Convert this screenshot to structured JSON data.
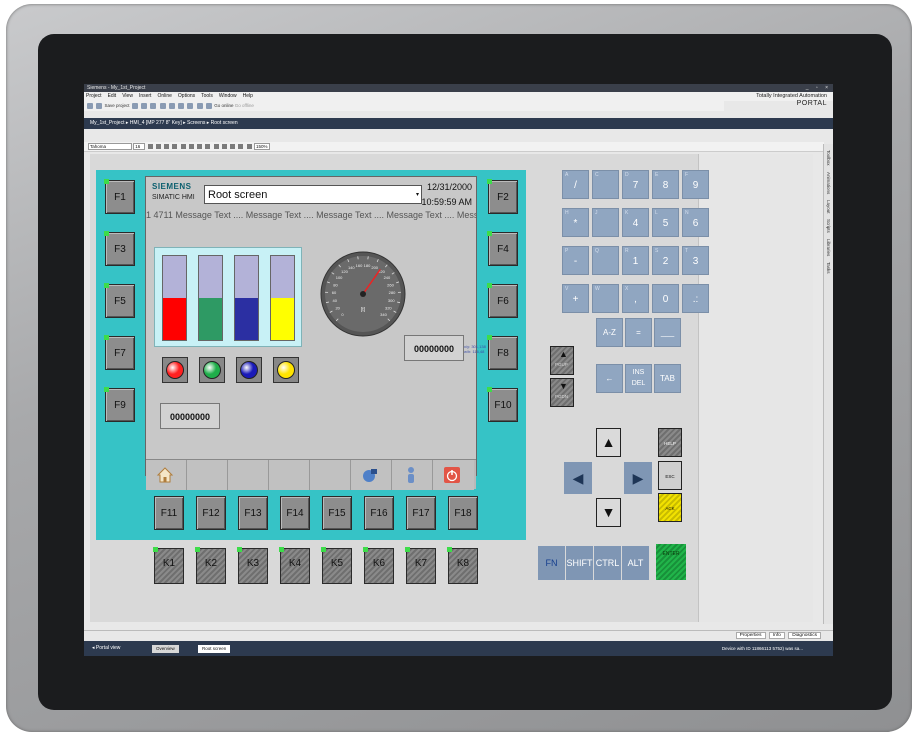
{
  "window": {
    "title": "Siemens - My_1st_Project",
    "brand_line1": "Totally Integrated Automation",
    "brand_line2": "PORTAL",
    "controls": "_ ▫ ×"
  },
  "menu": [
    "Project",
    "Edit",
    "View",
    "Insert",
    "Online",
    "Options",
    "Tools",
    "Window",
    "Help"
  ],
  "toolbar": {
    "save_label": "Save project",
    "go_online": "Go online",
    "go_offline": "Go offline"
  },
  "breadcrumb": "My_1st_Project ▸ HMI_4 [MP 277 8\" Key] ▸ Screens ▸ Root screen",
  "format_bar": {
    "font": "Tahoma",
    "size": "16",
    "zoom": "150%"
  },
  "side_tabs": [
    "Toolbox",
    "Animations",
    "Layout",
    "Scripts",
    "Libraries",
    "Tasks"
  ],
  "hmi": {
    "logo": "SIEMENS",
    "device_name": "SIMATIC HMI",
    "screen_name": "Root screen",
    "date": "12/31/2000",
    "time": "10:59:59 AM",
    "message_line": "1 4711 Message Text .... Message Text .... Message Text .... Message Text .... Message T...",
    "io_field_1": "00000000",
    "io_field_2": "00000000",
    "tanks": [
      {
        "color": "#ff0000",
        "level": 0.5
      },
      {
        "color": "#2e9a64",
        "level": 0.5
      },
      {
        "color": "#2b2fa2",
        "level": 0.5
      },
      {
        "color": "#ffff00",
        "level": 0.5
      }
    ],
    "lamps": [
      "#ff2020",
      "#1fae4a",
      "#1a1ab8",
      "#ffe400"
    ],
    "gauge": {
      "ticks": [
        "0",
        "20",
        "40",
        "60",
        "80",
        "100",
        "120",
        "140",
        "160",
        "180",
        "200",
        "220",
        "240",
        "260",
        "280",
        "300",
        "320",
        "340"
      ],
      "unit": "[t]",
      "value": 0.63
    },
    "coord_readout": "x/y: 301,138\nw/h: 116,48"
  },
  "fkeys_left": [
    "F1",
    "F3",
    "F5",
    "F7",
    "F9"
  ],
  "fkeys_right": [
    "F2",
    "F4",
    "F6",
    "F8",
    "F10"
  ],
  "fkeys_bottom": [
    "F11",
    "F12",
    "F13",
    "F14",
    "F15",
    "F16",
    "F17",
    "F18"
  ],
  "kkeys": [
    "K1",
    "K2",
    "K3",
    "K4",
    "K5",
    "K6",
    "K7",
    "K8"
  ],
  "keypad": {
    "rows": [
      [
        {
          "sub": "A",
          "main": "/"
        },
        {
          "sub": "C",
          "main": ""
        },
        {
          "sub": "D",
          "main": "7"
        },
        {
          "sub": "E",
          "main": "8"
        },
        {
          "sub": "F",
          "main": "9"
        }
      ],
      [
        {
          "sub": "H",
          "main": "*"
        },
        {
          "sub": "J",
          "main": ""
        },
        {
          "sub": "K",
          "main": "4"
        },
        {
          "sub": "L",
          "main": "5"
        },
        {
          "sub": "N",
          "main": "6"
        }
      ],
      [
        {
          "sub": "P",
          "main": "-"
        },
        {
          "sub": "Q",
          "main": ""
        },
        {
          "sub": "R",
          "main": "1"
        },
        {
          "sub": "S",
          "main": "2"
        },
        {
          "sub": "T",
          "main": "3"
        }
      ],
      [
        {
          "sub": "V",
          "main": "+"
        },
        {
          "sub": "W",
          "main": ""
        },
        {
          "sub": "X",
          "main": ","
        },
        {
          "sub": "",
          "main": "0"
        },
        {
          "sub": "",
          "main": ".:"
        }
      ]
    ],
    "az": "A-Z",
    "eq": "=",
    "space": "___",
    "backspace": "←",
    "ins": "INS",
    "del": "DEL",
    "tab": "TAB",
    "page_up": "PGUP",
    "page_down": "PGDN",
    "help": "HELP",
    "esc": "ESC",
    "ack": "ACK",
    "fn": "FN",
    "shift": "SHIFT",
    "ctrl": "CTRL",
    "alt": "ALT",
    "enter": "ENTER"
  },
  "status": {
    "properties": "Properties",
    "info": "Info",
    "diagnostics": "Diagnostics"
  },
  "taskbar": {
    "portal_view": "◂ Portal view",
    "tab1": "Overview",
    "tab2": "Root screen",
    "device_msg": "Device with ID 11866113 5752) was sa..."
  },
  "colors": {
    "hmi_body": "#36c3c6",
    "keypad_blue": "#90a6c1",
    "led_green": "#3ddc4a"
  }
}
